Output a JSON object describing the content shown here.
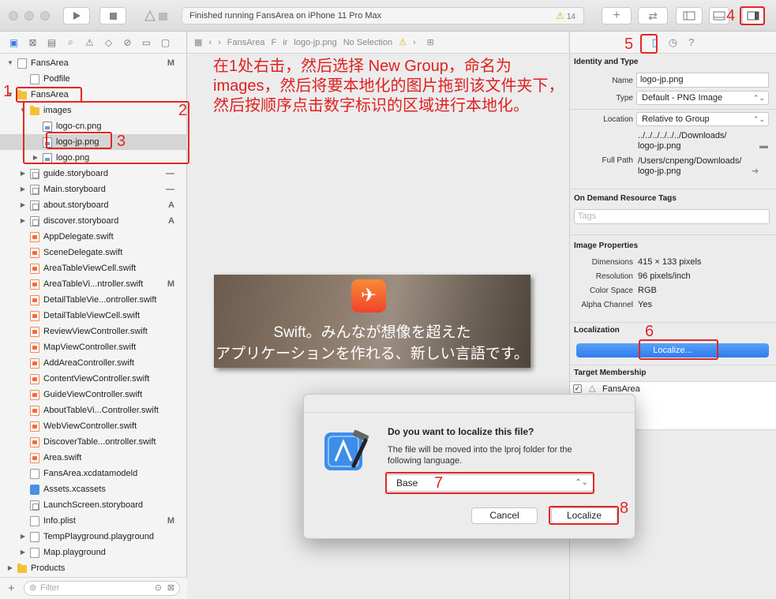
{
  "toolbar": {
    "status_text": "Finished running FansArea on iPhone 11 Pro Max",
    "warning_count": "14"
  },
  "navigator": {
    "items": [
      {
        "label": "FansArea",
        "badge": "M"
      },
      {
        "label": "Podfile",
        "badge": ""
      },
      {
        "label": "FansArea",
        "badge": ""
      },
      {
        "label": "images",
        "badge": ""
      },
      {
        "label": "logo-cn.png",
        "badge": ""
      },
      {
        "label": "logo-jp.png",
        "badge": ""
      },
      {
        "label": "logo.png",
        "badge": ""
      },
      {
        "label": "guide.storyboard",
        "badge": "—"
      },
      {
        "label": "Main.storyboard",
        "badge": "—"
      },
      {
        "label": "about.storyboard",
        "badge": "A"
      },
      {
        "label": "discover.storyboard",
        "badge": "A"
      },
      {
        "label": "AppDelegate.swift",
        "badge": ""
      },
      {
        "label": "SceneDelegate.swift",
        "badge": ""
      },
      {
        "label": "AreaTableViewCell.swift",
        "badge": ""
      },
      {
        "label": "AreaTableVi...ntroller.swift",
        "badge": "M"
      },
      {
        "label": "DetailTableVie...ontroller.swift",
        "badge": ""
      },
      {
        "label": "DetailTableViewCell.swift",
        "badge": ""
      },
      {
        "label": "ReviewViewController.swift",
        "badge": ""
      },
      {
        "label": "MapViewController.swift",
        "badge": ""
      },
      {
        "label": "AddAreaController.swift",
        "badge": ""
      },
      {
        "label": "ContentViewController.swift",
        "badge": ""
      },
      {
        "label": "GuideViewController.swift",
        "badge": ""
      },
      {
        "label": "AboutTableVi...Controller.swift",
        "badge": ""
      },
      {
        "label": "WebViewController.swift",
        "badge": ""
      },
      {
        "label": "DiscoverTable...ontroller.swift",
        "badge": ""
      },
      {
        "label": "Area.swift",
        "badge": ""
      },
      {
        "label": "FansArea.xcdatamodeld",
        "badge": ""
      },
      {
        "label": "Assets.xcassets",
        "badge": ""
      },
      {
        "label": "LaunchScreen.storyboard",
        "badge": ""
      },
      {
        "label": "Info.plist",
        "badge": "M"
      },
      {
        "label": "TempPlayground.playground",
        "badge": ""
      },
      {
        "label": "Map.playground",
        "badge": ""
      },
      {
        "label": "Products",
        "badge": ""
      }
    ],
    "filter_placeholder": "Filter"
  },
  "jumpbar": {
    "crumbs": [
      "FansArea",
      "F",
      "ir",
      "logo-jp.png",
      "No Selection"
    ]
  },
  "editor": {
    "instruction": "在1处右击，然后选择 New Group，命名为images，然后将要本地化的图片拖到该文件夹下，然后按顺序点击数字标识的区域进行本地化。",
    "preview_line1": "Swift。みんなが想像を超えた",
    "preview_line2": "アプリケーションを作れる、新しい言語です。"
  },
  "dialog": {
    "title": "Do you want to localize this file?",
    "message": "The file will be moved into the lproj folder for the following language.",
    "language": "Base",
    "cancel_label": "Cancel",
    "localize_label": "Localize"
  },
  "inspector": {
    "identity_title": "Identity and Type",
    "name_label": "Name",
    "name_value": "logo-jp.png",
    "type_label": "Type",
    "type_value": "Default - PNG Image",
    "location_label": "Location",
    "location_value": "Relative to Group",
    "location_path1": "../../../../../../Downloads/",
    "location_path2": "logo-jp.png",
    "fullpath_label": "Full Path",
    "fullpath_1": "/Users/cnpeng/Downloads/",
    "fullpath_2": "logo-jp.png",
    "ondemand_title": "On Demand Resource Tags",
    "tags_placeholder": "Tags",
    "image_title": "Image Properties",
    "dimensions_label": "Dimensions",
    "dimensions_value": "415 × 133 pixels",
    "resolution_label": "Resolution",
    "resolution_value": "96 pixels/inch",
    "colorspace_label": "Color Space",
    "colorspace_value": "RGB",
    "alpha_label": "Alpha Channel",
    "alpha_value": "Yes",
    "localization_title": "Localization",
    "localize_button": "Localize...",
    "target_title": "Target Membership",
    "target_name": "FansArea"
  },
  "annotations": {
    "n1": "1",
    "n2": "2",
    "n3": "3",
    "n4": "4",
    "n5": "5",
    "n6": "6",
    "n7": "7",
    "n8": "8"
  },
  "colors": {
    "annotation": "#e32626",
    "accent": "#2e7cf0",
    "folder": "#f3c132"
  }
}
